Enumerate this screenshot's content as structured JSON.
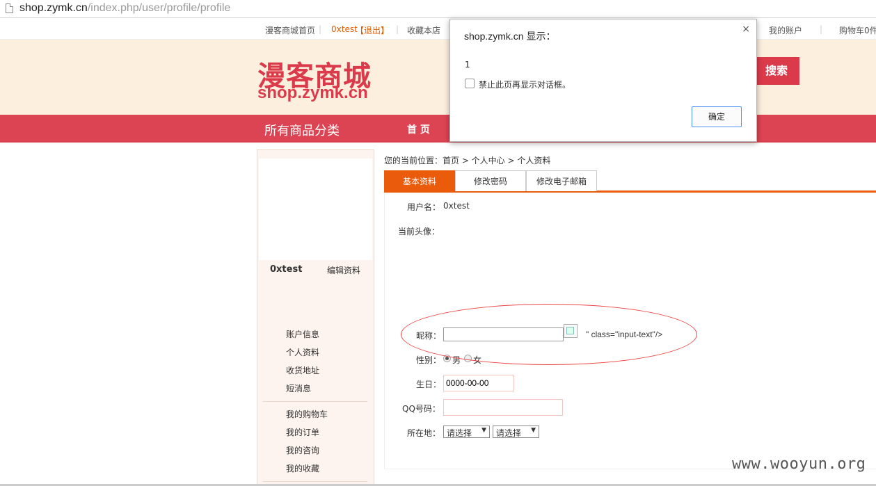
{
  "browser": {
    "url_host": "shop.zymk.cn",
    "url_path": "/index.php/user/profile/profile"
  },
  "toplinks": {
    "home": "漫客商城首页",
    "user": "0xtest",
    "logout": "【退出】",
    "sep": "|",
    "favorite": "收藏本店",
    "account": "我的账户",
    "cart": "购物车0件"
  },
  "header": {
    "logo_cn": "漫客商城",
    "logo_en": "shop.zymk.cn",
    "search_label": "搜索"
  },
  "nav": {
    "all_categories": "所有商品分类",
    "home": "首 页"
  },
  "sidebar": {
    "username": "0xtest",
    "edit_profile": "编辑资料",
    "group1": [
      "账户信息",
      "个人资料",
      "收货地址",
      "短消息"
    ],
    "group2": [
      "我的购物车",
      "我的订单",
      "我的咨询",
      "我的收藏"
    ]
  },
  "breadcrumb": "您的当前位置：首页 > 个人中心 > 个人资料",
  "tabs": [
    "基本资料",
    "修改密码",
    "修改电子邮箱"
  ],
  "form": {
    "username_label": "用户名：",
    "username_value": "0xtest",
    "avatar_label": "当前头像：",
    "nickname_label": "昵称：",
    "nickname_value": "",
    "injected_text": "\" class=\"input-text\"/>",
    "gender_label": "性别：",
    "gender_male": "男",
    "gender_female": "女",
    "birthday_label": "生日：",
    "birthday_value": "0000-00-00",
    "qq_label": "QQ号码：",
    "qq_value": "",
    "location_label": "所在地：",
    "province_selected": "请选择",
    "city_selected": "请选择"
  },
  "dialog": {
    "title": "shop.zymk.cn 显示：",
    "close": "×",
    "message": "1",
    "checkbox_label": "禁止此页再显示对话框。",
    "ok_label": "确定"
  },
  "watermark": "www.wooyun.org",
  "colors": {
    "brand_red": "#db3a4b",
    "tab_orange": "#ea5b0c",
    "header_bg": "#fcefdd",
    "annotation_red": "#e44"
  }
}
